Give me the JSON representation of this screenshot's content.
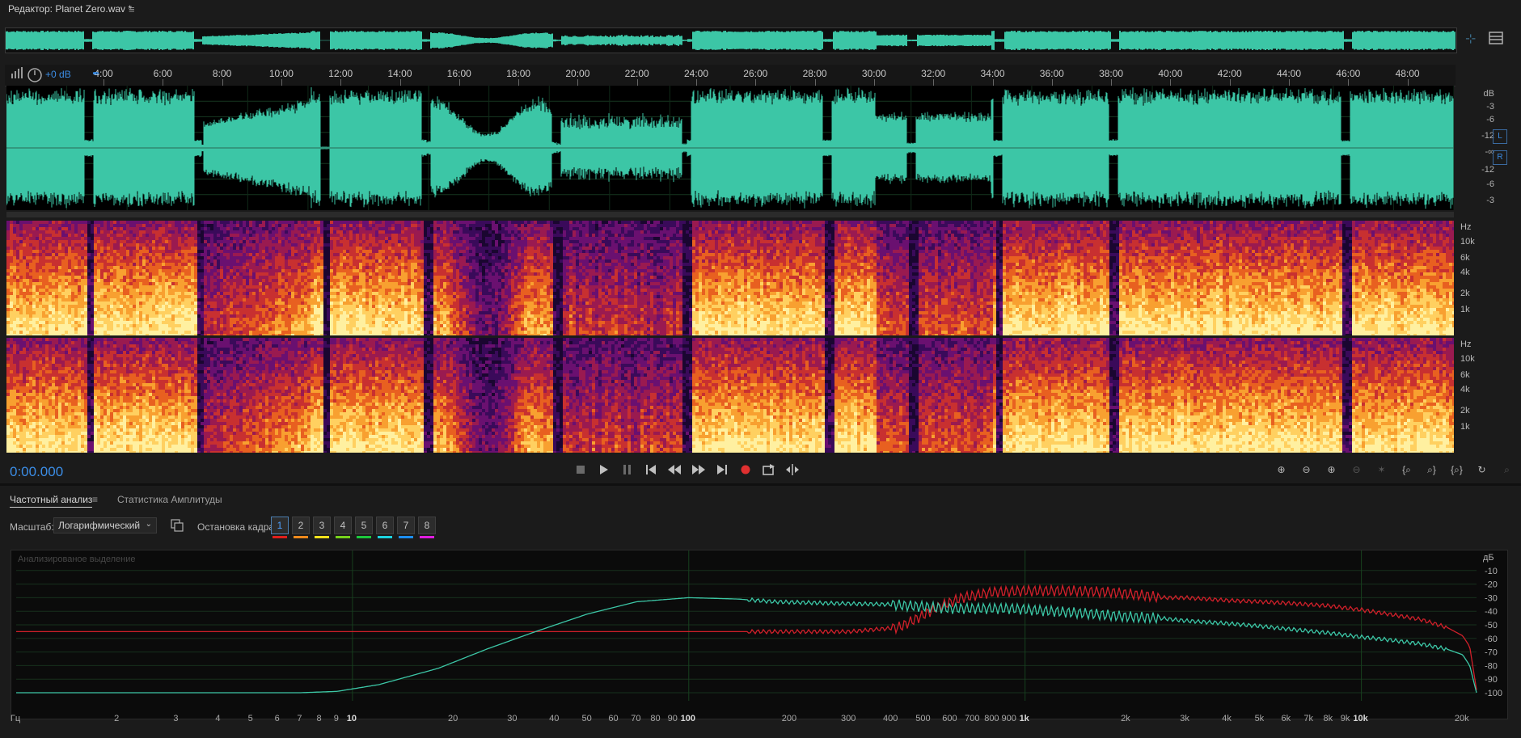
{
  "editor": {
    "title": "Редактор: Planet Zero.wav *",
    "menu_icon": "hamburger-menu-icon"
  },
  "hud": {
    "gain": "+0 dB"
  },
  "ruler": {
    "labels": [
      "4:00",
      "6:00",
      "8:00",
      "10:00",
      "12:00",
      "14:00",
      "16:00",
      "18:00",
      "20:00",
      "22:00",
      "24:00",
      "26:00",
      "28:00",
      "30:00",
      "32:00",
      "34:00",
      "36:00",
      "38:00",
      "40:00",
      "42:00",
      "44:00",
      "46:00",
      "48:00"
    ]
  },
  "waveform": {
    "color": "#3cc6a6",
    "db_labels": [
      "dB",
      "-3",
      "-6",
      "-12",
      "-∞",
      "-12",
      "-6",
      "-3"
    ],
    "channel_labels": [
      "L",
      "R"
    ]
  },
  "spectral": {
    "hz_labels_1": [
      "Hz",
      "10k",
      "6k",
      "4k",
      "2k",
      "1k"
    ],
    "hz_labels_2": [
      "Hz",
      "10k",
      "6k",
      "4k",
      "2k",
      "1k"
    ]
  },
  "transport": {
    "timecode": "0:00.000",
    "buttons": [
      "stop",
      "play",
      "pause",
      "to-start",
      "rewind",
      "fast-forward",
      "to-end",
      "record",
      "loop",
      "skip-selection"
    ]
  },
  "panel": {
    "tab_freq": "Частотный анализ",
    "tab_amp": "Статистика Амплитуды",
    "scale_label": "Масштаб:",
    "scale_value": "Логарифмический",
    "hold_label": "Остановка кадра:",
    "hold_buttons": [
      "1",
      "2",
      "3",
      "4",
      "5",
      "6",
      "7",
      "8"
    ],
    "hold_colors": [
      "#e0201c",
      "#f08a1c",
      "#f2e21c",
      "#76d21c",
      "#1cc83c",
      "#1cd4e0",
      "#1c8ef2",
      "#e01ce0"
    ],
    "overlay_text": "Анализированое выделение"
  },
  "analysis": {
    "db_unit": "дБ",
    "db_ticks": [
      "-10",
      "-20",
      "-30",
      "-40",
      "-50",
      "-60",
      "-70",
      "-80",
      "-90",
      "-100"
    ],
    "freq_labels": [
      {
        "t": "Гц",
        "f": 1
      },
      {
        "t": "2",
        "f": 2
      },
      {
        "t": "3",
        "f": 3
      },
      {
        "t": "4",
        "f": 4
      },
      {
        "t": "5",
        "f": 5
      },
      {
        "t": "6",
        "f": 6
      },
      {
        "t": "7",
        "f": 7
      },
      {
        "t": "8",
        "f": 8
      },
      {
        "t": "9",
        "f": 9
      },
      {
        "t": "10",
        "f": 10,
        "m": true
      },
      {
        "t": "20",
        "f": 20
      },
      {
        "t": "30",
        "f": 30
      },
      {
        "t": "40",
        "f": 40
      },
      {
        "t": "50",
        "f": 50
      },
      {
        "t": "60",
        "f": 60
      },
      {
        "t": "70",
        "f": 70
      },
      {
        "t": "80",
        "f": 80
      },
      {
        "t": "90",
        "f": 90
      },
      {
        "t": "100",
        "f": 100,
        "m": true
      },
      {
        "t": "200",
        "f": 200
      },
      {
        "t": "300",
        "f": 300
      },
      {
        "t": "400",
        "f": 400
      },
      {
        "t": "500",
        "f": 500
      },
      {
        "t": "600",
        "f": 600
      },
      {
        "t": "700",
        "f": 700
      },
      {
        "t": "800",
        "f": 800
      },
      {
        "t": "900",
        "f": 900
      },
      {
        "t": "1k",
        "f": 1000,
        "m": true
      },
      {
        "t": "2k",
        "f": 2000
      },
      {
        "t": "3k",
        "f": 3000
      },
      {
        "t": "4k",
        "f": 4000
      },
      {
        "t": "5k",
        "f": 5000
      },
      {
        "t": "6k",
        "f": 6000
      },
      {
        "t": "7k",
        "f": 7000
      },
      {
        "t": "8k",
        "f": 8000
      },
      {
        "t": "9k",
        "f": 9000
      },
      {
        "t": "10k",
        "f": 10000,
        "m": true
      },
      {
        "t": "20k",
        "f": 20000
      }
    ],
    "series": [
      {
        "color": "#d0202a",
        "points": [
          [
            1,
            -55
          ],
          [
            300,
            -55
          ],
          [
            420,
            -52
          ],
          [
            480,
            -45
          ],
          [
            550,
            -37
          ],
          [
            650,
            -30
          ],
          [
            800,
            -26
          ],
          [
            1000,
            -25
          ],
          [
            1400,
            -25
          ],
          [
            1800,
            -26
          ],
          [
            2200,
            -28
          ],
          [
            2600,
            -30
          ],
          [
            3000,
            -30
          ],
          [
            4000,
            -32
          ],
          [
            5000,
            -33
          ],
          [
            6000,
            -34
          ],
          [
            8000,
            -36
          ],
          [
            10000,
            -39
          ],
          [
            12000,
            -42
          ],
          [
            15000,
            -46
          ],
          [
            18000,
            -52
          ],
          [
            20000,
            -58
          ],
          [
            21000,
            -66
          ],
          [
            22000,
            -98
          ]
        ]
      },
      {
        "color": "#3cc6a6",
        "points": [
          [
            1,
            -100
          ],
          [
            5,
            -100
          ],
          [
            7,
            -100
          ],
          [
            9,
            -99
          ],
          [
            12,
            -94
          ],
          [
            18,
            -82
          ],
          [
            25,
            -68
          ],
          [
            35,
            -55
          ],
          [
            50,
            -42
          ],
          [
            70,
            -33
          ],
          [
            100,
            -30
          ],
          [
            140,
            -31
          ],
          [
            180,
            -33
          ],
          [
            250,
            -34
          ],
          [
            400,
            -35
          ],
          [
            600,
            -38
          ],
          [
            900,
            -38
          ],
          [
            1200,
            -40
          ],
          [
            1600,
            -42
          ],
          [
            2000,
            -44
          ],
          [
            2500,
            -45
          ],
          [
            3000,
            -47
          ],
          [
            4000,
            -49
          ],
          [
            5000,
            -51
          ],
          [
            6000,
            -53
          ],
          [
            8000,
            -56
          ],
          [
            10000,
            -59
          ],
          [
            12000,
            -61
          ],
          [
            15000,
            -64
          ],
          [
            18000,
            -68
          ],
          [
            20000,
            -72
          ],
          [
            21000,
            -80
          ],
          [
            22000,
            -100
          ]
        ]
      }
    ]
  }
}
